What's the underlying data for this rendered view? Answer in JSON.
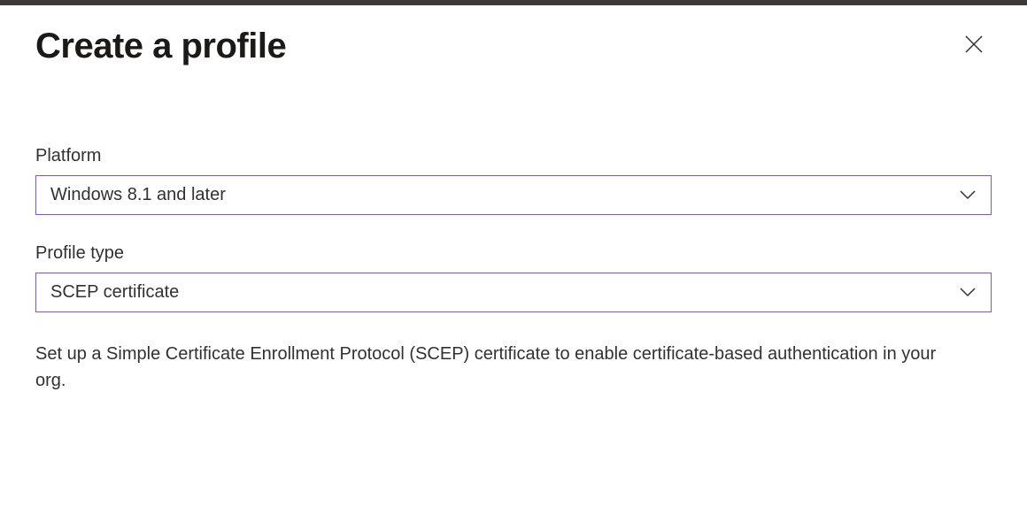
{
  "header": {
    "title": "Create a profile"
  },
  "form": {
    "platform": {
      "label": "Platform",
      "value": "Windows 8.1 and later"
    },
    "profileType": {
      "label": "Profile type",
      "value": "SCEP certificate"
    },
    "description": "Set up a Simple Certificate Enrollment Protocol (SCEP) certificate to enable certificate-based authentication in your org."
  },
  "colors": {
    "dropdownBorder": "#7a5ea8",
    "textPrimary": "#1b1a19",
    "textSecondary": "#323130"
  }
}
